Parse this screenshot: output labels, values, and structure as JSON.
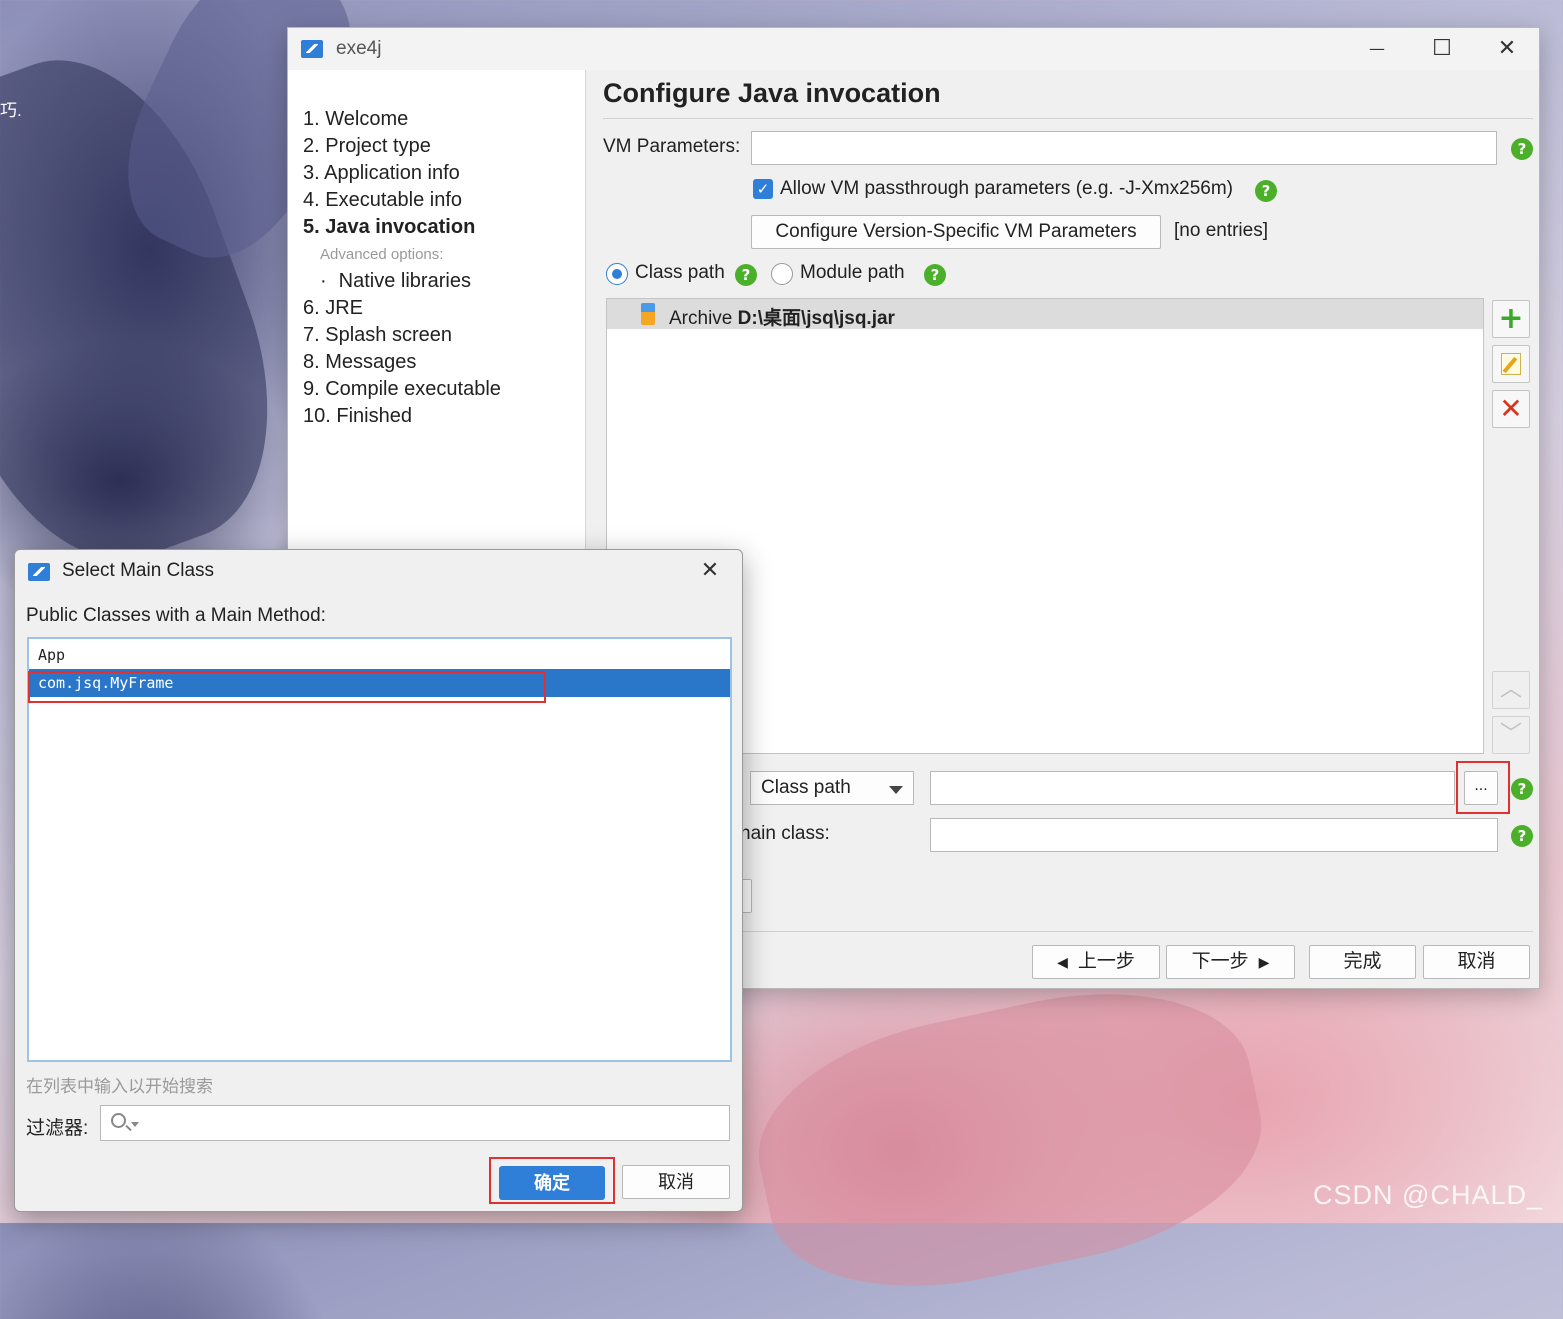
{
  "desktop": {
    "edge_text": "巧.",
    "watermark": "CSDN @CHALD_"
  },
  "main_window": {
    "title": "exe4j",
    "controls": {
      "minimize": "—",
      "maximize": "☐",
      "close": "✕"
    },
    "steps": [
      "1. Welcome",
      "2. Project type",
      "3. Application info",
      "4. Executable info",
      "5. Java invocation",
      "Advanced options:",
      "Native libraries",
      "6. JRE",
      "7. Splash screen",
      "8. Messages",
      "9. Compile executable",
      "10. Finished"
    ],
    "active_step": "5. Java invocation",
    "page_title": "Configure Java invocation",
    "vm_parameters": {
      "label": "VM Parameters:",
      "value": ""
    },
    "allow_passthrough": {
      "label": "Allow VM passthrough parameters (e.g. -J-Xmx256m)",
      "checked": true
    },
    "version_specific_button": "Configure Version-Specific VM Parameters",
    "version_specific_status": "[no entries]",
    "path_mode": {
      "class_path_label": "Class path",
      "module_path_label": "Module path",
      "selected": "Class path"
    },
    "classpath_entry": {
      "type": "Archive",
      "path": "D:\\桌面\\jsq\\jsq.jar"
    },
    "main_class_from": {
      "value": "Class path",
      "field_value": "",
      "browse_label": "..."
    },
    "main_class_label_partial": "nain class:",
    "main_class_value": "",
    "nav_buttons": {
      "back": "上一步",
      "next": "下一步",
      "finish": "完成",
      "cancel": "取消"
    },
    "help_glyph": "?"
  },
  "dialog": {
    "title": "Select Main Class",
    "close": "✕",
    "list_label": "Public Classes with a Main Method:",
    "classes": [
      "App",
      "com.jsq.MyFrame"
    ],
    "selected_class": "com.jsq.MyFrame",
    "search_hint": "在列表中输入以开始搜索",
    "filter_label": "过滤器:",
    "filter_value": "",
    "filter_icon": "search-icon",
    "ok_label": "确定",
    "cancel_label": "取消"
  },
  "colors": {
    "accent": "#2f7ed8",
    "selection": "#2a77c9",
    "help": "#4caf2a",
    "highlight_box": "#e03131"
  }
}
